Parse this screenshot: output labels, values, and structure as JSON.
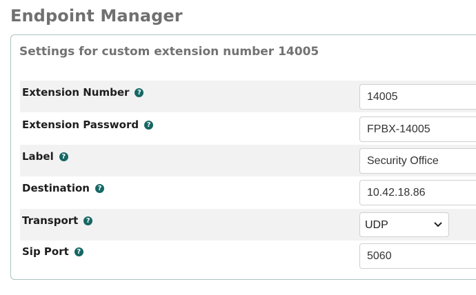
{
  "page": {
    "title": "Endpoint Manager"
  },
  "panel": {
    "heading": "Settings for custom extension number 14005"
  },
  "fields": {
    "extension_number": {
      "label": "Extension Number",
      "value": "14005"
    },
    "extension_password": {
      "label": "Extension Password",
      "value": "FPBX-14005"
    },
    "label": {
      "label": "Label",
      "value": "Security Office"
    },
    "destination": {
      "label": "Destination",
      "value": "10.42.18.86"
    },
    "transport": {
      "label": "Transport",
      "value": "UDP"
    },
    "sip_port": {
      "label": "Sip Port",
      "value": "5060"
    }
  },
  "icons": {
    "help": "question-circle-icon",
    "dropdown": "chevron-down-icon"
  },
  "colors": {
    "title": "#707070",
    "heading": "#727272",
    "help_icon": "#176764",
    "row_shade": "#f2f2f2",
    "panel_border": "#a9c2c0"
  }
}
